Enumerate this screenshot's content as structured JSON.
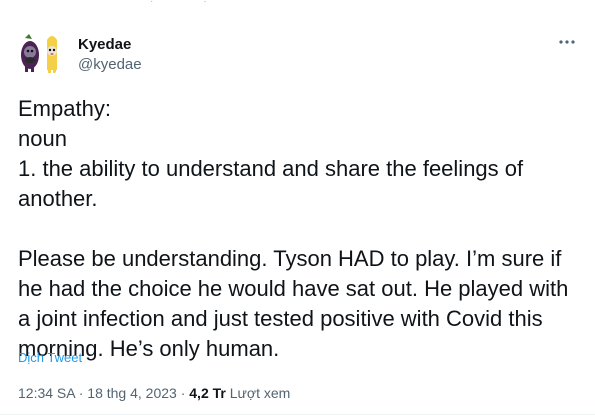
{
  "author": {
    "name": "Kyedae",
    "handle": "@kyedae"
  },
  "tweet": {
    "text": "Empathy:\nnoun\n1. the ability to understand and share the feelings of another.\n\nPlease be understanding. Tyson HAD to play. I’m sure if he had the choice he would have sat out. He played with a joint infection and just tested positive with Covid this morning. He’s only human.",
    "translate_label": "Dịch Tweet"
  },
  "meta": {
    "time": "12:34 SA",
    "separator": " · ",
    "date": "18 thg 4, 2023",
    "views_count": "4,2 Tr",
    "views_label": "Lượt xem"
  },
  "icons": {
    "more": "more-horizontal-icon",
    "avatar": "eggplant-and-banana-cat-avatar"
  },
  "colors": {
    "text": "#0f1419",
    "secondary": "#536471",
    "link": "#1d9bf0"
  }
}
